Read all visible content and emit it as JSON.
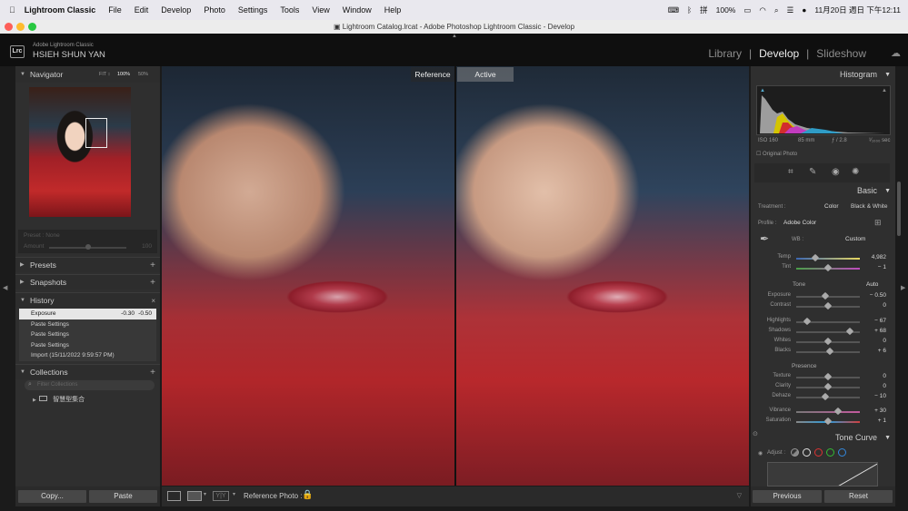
{
  "menubar": {
    "app_name": "Lightroom Classic",
    "items": [
      "File",
      "Edit",
      "Develop",
      "Photo",
      "Settings",
      "Tools",
      "View",
      "Window",
      "Help"
    ],
    "battery": "100%",
    "datetime": "11月20日 週日 下午12:11"
  },
  "window": {
    "title": "Lightroom Catalog.lrcat - Adobe Photoshop Lightroom Classic - Develop"
  },
  "identity": {
    "logo": "Lrc",
    "product": "Adobe Lightroom Classic",
    "user": "HSIEH SHUN YAN"
  },
  "modules": [
    "Library",
    "Develop",
    "Slideshow"
  ],
  "navigator": {
    "title": "Navigator",
    "zooms": [
      "FIT ↕",
      "100%",
      "50%"
    ]
  },
  "preset_box": {
    "preset": "Preset : None",
    "amount_label": "Amount",
    "amount_value": "100"
  },
  "panels": {
    "presets": "Presets",
    "snapshots": "Snapshots",
    "history": "History",
    "collections": "Collections"
  },
  "history": [
    {
      "label": "Exposure",
      "v1": "-0.30",
      "v2": "-0.50",
      "selected": true
    },
    {
      "label": "Paste Settings"
    },
    {
      "label": "Paste Settings"
    },
    {
      "label": "Paste Settings"
    },
    {
      "label": "Import (15/11/2022 9:59:57 PM)"
    }
  ],
  "collections": {
    "search_placeholder": "Filter Collections",
    "item": "智慧型集合"
  },
  "left_buttons": {
    "copy": "Copy...",
    "paste": "Paste"
  },
  "view_tags": {
    "reference": "Reference",
    "active": "Active"
  },
  "toolbar": {
    "reference_photo": "Reference Photo :"
  },
  "histogram": {
    "title": "Histogram",
    "iso": "ISO 160",
    "focal": "85 mm",
    "aperture": "ƒ / 2.8",
    "shutter": "¹⁄₁₀₀₀ sec",
    "original_photo": "Original Photo"
  },
  "basic": {
    "title": "Basic",
    "treatment_label": "Treatment :",
    "treatment_color": "Color",
    "treatment_bw": "Black & White",
    "profile_label": "Profile :",
    "profile_value": "Adobe Color",
    "wb_label": "WB :",
    "wb_value": "Custom",
    "tone_label": "Tone",
    "auto_label": "Auto",
    "presence_label": "Presence",
    "sliders": [
      {
        "label": "Temp",
        "value": "4,982",
        "level": 0.3
      },
      {
        "label": "Tint",
        "value": "− 1",
        "level": 0.5
      },
      {
        "label": "Exposure",
        "value": "− 0.50",
        "level": 0.46
      },
      {
        "label": "Contrast",
        "value": "0",
        "level": 0.5
      },
      {
        "label": "Highlights",
        "value": "− 67",
        "level": 0.17
      },
      {
        "label": "Shadows",
        "value": "+ 68",
        "level": 0.84
      },
      {
        "label": "Whites",
        "value": "0",
        "level": 0.5
      },
      {
        "label": "Blacks",
        "value": "+ 6",
        "level": 0.53
      },
      {
        "label": "Texture",
        "value": "0",
        "level": 0.5
      },
      {
        "label": "Clarity",
        "value": "0",
        "level": 0.5
      },
      {
        "label": "Dehaze",
        "value": "− 10",
        "level": 0.45
      },
      {
        "label": "Vibrance",
        "value": "+ 30",
        "level": 0.65
      },
      {
        "label": "Saturation",
        "value": "+ 1",
        "level": 0.5
      }
    ]
  },
  "tone_curve": {
    "title": "Tone Curve",
    "adjust_label": "Adjust :"
  },
  "right_buttons": {
    "previous": "Previous",
    "reset": "Reset"
  },
  "colors": {
    "accent": "#e6e6e6",
    "panel": "#2f2f2f",
    "bg": "#1b1b1b"
  }
}
